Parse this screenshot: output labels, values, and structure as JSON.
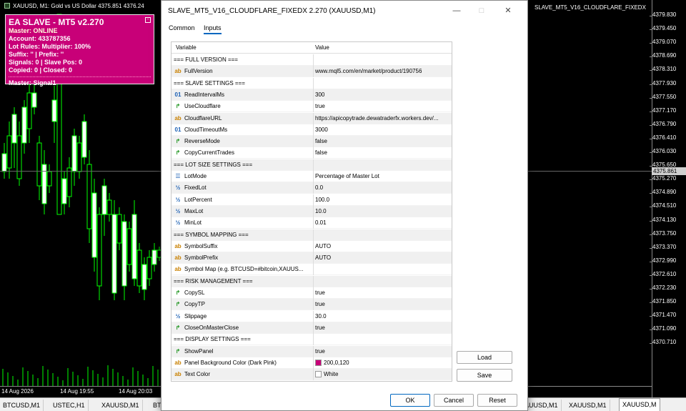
{
  "chart": {
    "title": "XAUUSD, M1:  Gold vs US Dollar  4375.851 4376.24",
    "right_label": "SLAVE_MT5_V16_CLOUDFLARE_FIXEDX",
    "current_price": "4375.861",
    "price_ticks": [
      "4379.830",
      "4379.450",
      "4379.070",
      "4378.690",
      "4378.310",
      "4377.930",
      "4377.550",
      "4377.170",
      "4376.790",
      "4376.410",
      "4376.030",
      "4375.650",
      "4375.270",
      "4374.890",
      "4374.510",
      "4374.130",
      "4373.750",
      "4373.370",
      "4372.990",
      "4372.610",
      "4372.230",
      "4371.850",
      "4371.470",
      "4371.090",
      "4370.710"
    ],
    "time_labels": [
      "14 Aug 2026",
      "14 Aug 19:55",
      "14 Aug 20:03"
    ]
  },
  "panel": {
    "title": "EA SLAVE - MT5 v2.270",
    "status": "Master: ONLINE",
    "account": "Account: 433787356",
    "lot_rules": "Lot Rules: Multiplier: 100%",
    "suffix": "Suffix: '' | Prefix: ''",
    "signals": "Signals: 0 | Slave Pos: 0",
    "copied": "Copied: 0 | Closed: 0",
    "master": "Master: Signal1",
    "minimize": "-"
  },
  "dialog": {
    "title": "SLAVE_MT5_V16_CLOUDFLARE_FIXEDX 2.270 (XAUUSD,M1)",
    "tabs": [
      "Common",
      "Inputs"
    ],
    "col_variable": "Variable",
    "col_value": "Value",
    "rows": [
      {
        "icon": "",
        "var": "=== FULL VERSION ===",
        "val": ""
      },
      {
        "icon": "ab",
        "var": "FullVersion",
        "val": "www.mql5.com/en/market/product/190756"
      },
      {
        "icon": "",
        "var": "=== SLAVE SETTINGS ===",
        "val": ""
      },
      {
        "icon": "01",
        "var": "ReadIntervalMs",
        "val": "300"
      },
      {
        "icon": "bool",
        "var": "UseCloudflare",
        "val": "true"
      },
      {
        "icon": "ab",
        "var": "CloudflareURL",
        "val": "https://apicopytrade.dewatraderfx.workers.dev/..."
      },
      {
        "icon": "01",
        "var": "CloudTimeoutMs",
        "val": "3000"
      },
      {
        "icon": "bool",
        "var": "ReverseMode",
        "val": "false"
      },
      {
        "icon": "bool",
        "var": "CopyCurrentTrades",
        "val": "false"
      },
      {
        "icon": "",
        "var": "=== LOT SIZE SETTINGS ===",
        "val": ""
      },
      {
        "icon": "enum",
        "var": "LotMode",
        "val": "Percentage of Master Lot"
      },
      {
        "icon": "half",
        "var": "FixedLot",
        "val": "0.0"
      },
      {
        "icon": "half",
        "var": "LotPercent",
        "val": "100.0"
      },
      {
        "icon": "half",
        "var": "MaxLot",
        "val": "10.0"
      },
      {
        "icon": "half",
        "var": "MinLot",
        "val": "0.01"
      },
      {
        "icon": "",
        "var": "=== SYMBOL MAPPING ===",
        "val": ""
      },
      {
        "icon": "ab",
        "var": "SymbolSuffix",
        "val": "AUTO"
      },
      {
        "icon": "ab",
        "var": "SymbolPrefix",
        "val": "AUTO"
      },
      {
        "icon": "ab",
        "var": "Symbol Map (e.g. BTCUSD=#bitcoin,XAUUS...",
        "val": ""
      },
      {
        "icon": "",
        "var": "=== RISK MANAGEMENT ===",
        "val": ""
      },
      {
        "icon": "bool",
        "var": "CopySL",
        "val": "true"
      },
      {
        "icon": "bool",
        "var": "CopyTP",
        "val": "true"
      },
      {
        "icon": "half",
        "var": "Slippage",
        "val": "30.0"
      },
      {
        "icon": "bool",
        "var": "CloseOnMasterClose",
        "val": "true"
      },
      {
        "icon": "",
        "var": "=== DISPLAY SETTINGS ===",
        "val": ""
      },
      {
        "icon": "bool",
        "var": "ShowPanel",
        "val": "true"
      },
      {
        "icon": "color",
        "var": "Panel Background Color (Dark Pink)",
        "val": "200,0,120",
        "swatch": "#c80078"
      },
      {
        "icon": "color",
        "var": "Text Color",
        "val": "White",
        "swatch": "#ffffff"
      }
    ],
    "load": "Load",
    "save": "Save",
    "ok": "OK",
    "cancel": "Cancel",
    "reset": "Reset"
  },
  "bottom_tabs": [
    "BTCUSD,M1",
    "USTEC,H1",
    "XAUUSD,M1",
    "BT",
    "XAUUSD,M1",
    "XAUUSD,M1",
    "XAUUSD,M"
  ],
  "colors": {
    "panel_bg": "#c80078",
    "candle": "#00ff00",
    "accent": "#0067c0"
  }
}
